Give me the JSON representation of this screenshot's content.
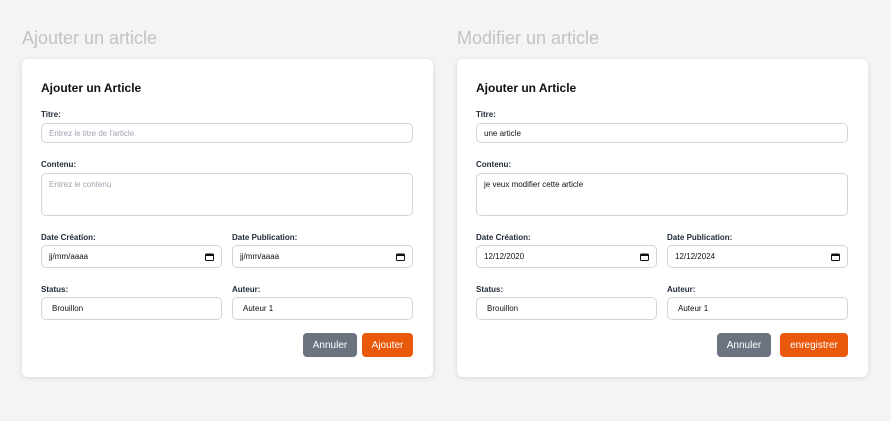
{
  "left": {
    "heading": "Ajouter un article",
    "card_title": "Ajouter un Article",
    "titre_label": "Titre:",
    "titre_placeholder": "Entrez le titre de l'article",
    "contenu_label": "Contenu:",
    "contenu_placeholder": "Entrez le contenu",
    "date_creation_label": "Date Création:",
    "date_creation_value": "jj/mm/aaaa",
    "date_publication_label": "Date Publication:",
    "date_publication_value": "jj/mm/aaaa",
    "status_label": "Status:",
    "status_value": "Brouillon",
    "auteur_label": "Auteur:",
    "auteur_value": "Auteur 1",
    "cancel_label": "Annuler",
    "submit_label": "Ajouter"
  },
  "right": {
    "heading": "Modifier un article",
    "card_title": "Ajouter un Article",
    "titre_label": "Titre:",
    "titre_value": "une article",
    "contenu_label": "Contenu:",
    "contenu_value": "je veux modifier cette article",
    "date_creation_label": "Date Création:",
    "date_creation_value": "12/12/2020",
    "date_publication_label": "Date Publication:",
    "date_publication_value": "12/12/2024",
    "status_label": "Status:",
    "status_value": "Brouillon",
    "auteur_label": "Auteur:",
    "auteur_value": "Auteur 1",
    "cancel_label": "Annuler",
    "submit_label": "enregistrer"
  },
  "icons": {
    "date_picker": "calendar-icon"
  },
  "colors": {
    "primary": "#ea580c",
    "cancel": "#6b7280",
    "background": "#f4f4f4",
    "heading": "#c3c3c3"
  }
}
